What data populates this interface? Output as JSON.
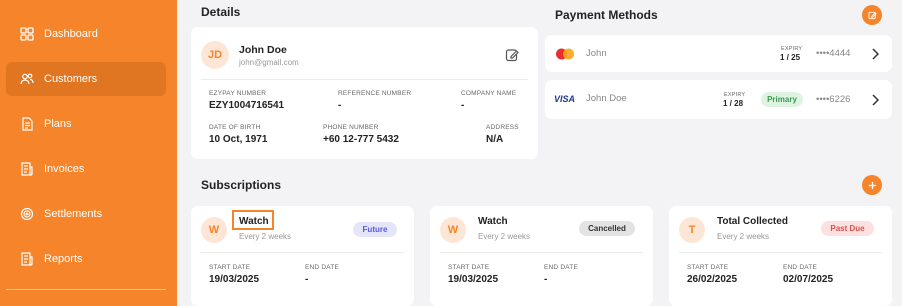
{
  "sidebar": {
    "items": [
      {
        "label": "Dashboard"
      },
      {
        "label": "Customers"
      },
      {
        "label": "Plans"
      },
      {
        "label": "Invoices"
      },
      {
        "label": "Settlements"
      },
      {
        "label": "Reports"
      }
    ]
  },
  "details": {
    "title": "Details",
    "avatar_initials": "JD",
    "name": "John Doe",
    "email": "john@gmail.com",
    "fields": [
      {
        "label": "EZYPAY NUMBER",
        "value": "EZY1004716541"
      },
      {
        "label": "REFERENCE NUMBER",
        "value": "-"
      },
      {
        "label": "COMPANY NAME",
        "value": "-"
      },
      {
        "label": "DATE OF BIRTH",
        "value": "10 Oct, 1971"
      },
      {
        "label": "PHONE NUMBER",
        "value": "+60 12-777 5432"
      },
      {
        "label": "ADDRESS",
        "value": "N/A"
      }
    ]
  },
  "payment_methods": {
    "title": "Payment Methods",
    "cards": [
      {
        "brand": "mastercard-icon",
        "holder": "John",
        "expiry_label": "EXPIRY",
        "expiry": "1 / 25",
        "badge": "",
        "number": "••••4444"
      },
      {
        "brand": "visa-icon",
        "brand_text": "VISA",
        "holder": "John Doe",
        "expiry_label": "EXPIRY",
        "expiry": "1 / 28",
        "badge": "Primary",
        "number": "••••6226"
      }
    ]
  },
  "subscriptions": {
    "title": "Subscriptions",
    "items": [
      {
        "initial": "W",
        "name": "Watch",
        "frequency": "Every 2 weeks",
        "status": "Future",
        "start_label": "START DATE",
        "start": "19/03/2025",
        "end_label": "END DATE",
        "end": "-"
      },
      {
        "initial": "W",
        "name": "Watch",
        "frequency": "Every 2 weeks",
        "status": "Cancelled",
        "start_label": "START DATE",
        "start": "19/03/2025",
        "end_label": "END DATE",
        "end": "-"
      },
      {
        "initial": "T",
        "name": "Total Collected",
        "frequency": "Every 2 weeks",
        "status": "Past Due",
        "start_label": "START DATE",
        "start": "26/02/2025",
        "end_label": "END DATE",
        "end": "02/07/2025"
      }
    ]
  },
  "colors": {
    "accent": "#f5842a",
    "future_badge_bg": "#e4e4fb",
    "future_badge_text": "#5a5ad6",
    "cancelled_badge_bg": "#e3e3e3",
    "pastdue_badge_bg": "#fde0e0",
    "pastdue_badge_text": "#d9534f",
    "primary_badge_bg": "#dff3e3",
    "primary_badge_text": "#3a9a52"
  }
}
